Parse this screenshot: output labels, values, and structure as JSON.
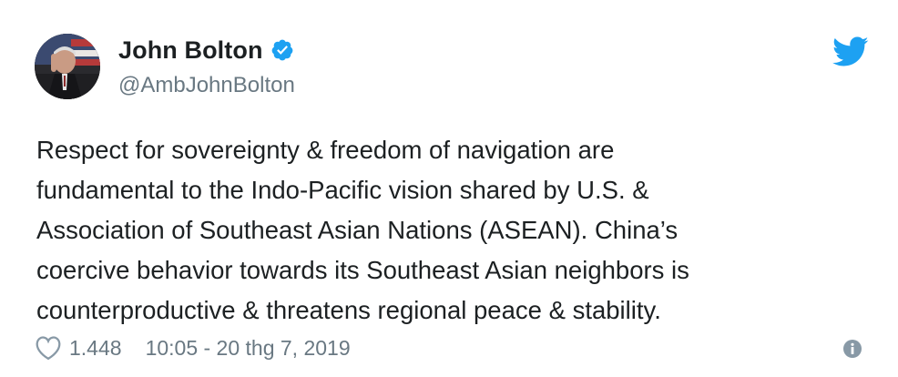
{
  "author": {
    "display_name": "John Bolton",
    "handle": "@AmbJohnBolton",
    "verified": true
  },
  "tweet": {
    "text": "Respect for sovereignty & freedom of navigation are\nfundamental to the Indo-Pacific vision shared by U.S. &\nAssociation of Southeast Asian Nations (ASEAN). China’s\ncoercive behavior towards its Southeast Asian neighbors is\ncounterproductive & threatens regional peace & stability."
  },
  "footer": {
    "like_count": "1.448",
    "timestamp": "10:05 - 20 thg 7, 2019"
  },
  "icons": {
    "brand": "twitter-bird-icon",
    "verified": "verified-badge-icon",
    "like": "heart-icon",
    "info": "info-icon"
  },
  "colors": {
    "brand_blue": "#1da1f2",
    "text": "#1c2022",
    "secondary_text": "#697882",
    "icon_gray": "#8899a6"
  }
}
